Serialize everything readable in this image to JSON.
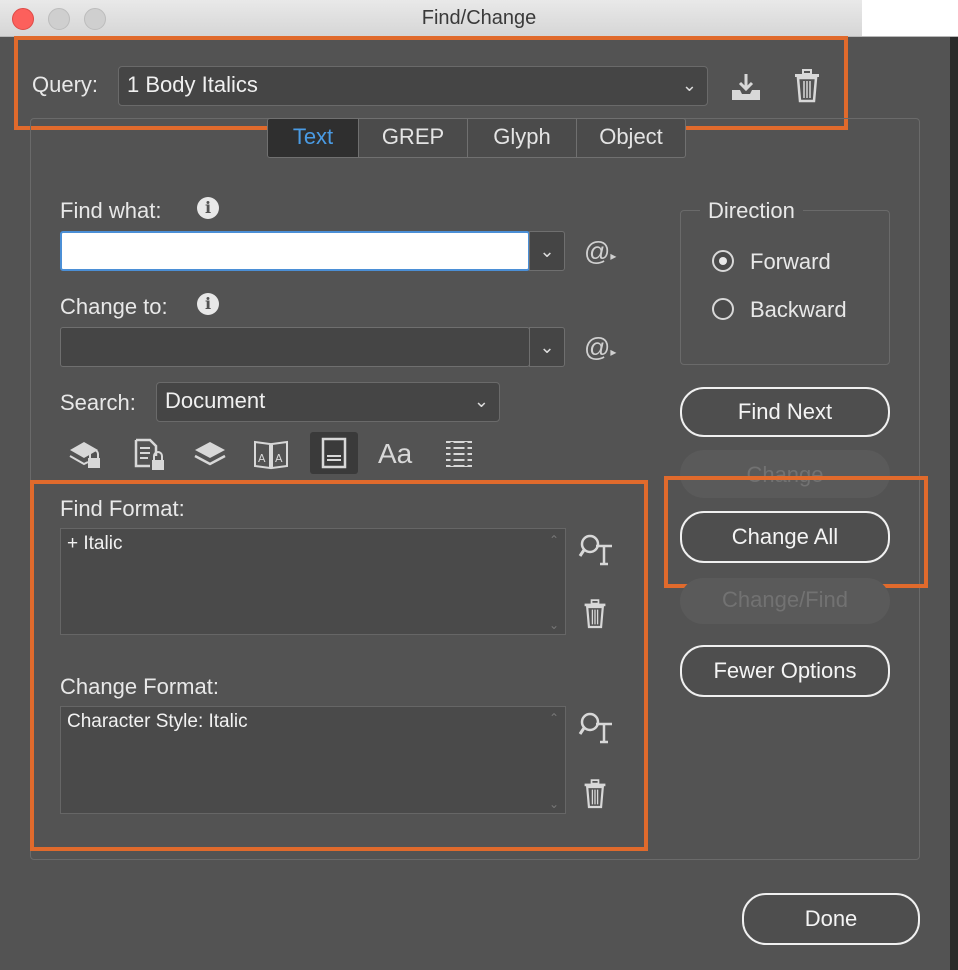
{
  "window": {
    "title": "Find/Change"
  },
  "query": {
    "label": "Query:",
    "value": "1 Body Italics"
  },
  "tabs": [
    {
      "label": "Text",
      "active": true
    },
    {
      "label": "GREP",
      "active": false
    },
    {
      "label": "Glyph",
      "active": false
    },
    {
      "label": "Object",
      "active": false
    }
  ],
  "find_what": {
    "label": "Find what:",
    "value": ""
  },
  "change_to": {
    "label": "Change to:",
    "value": ""
  },
  "search": {
    "label": "Search:",
    "value": "Document"
  },
  "direction": {
    "label": "Direction",
    "forward": "Forward",
    "backward": "Backward",
    "selected": "Forward"
  },
  "find_format": {
    "label": "Find Format:",
    "value": "+ Italic"
  },
  "change_format": {
    "label": "Change Format:",
    "value": "Character Style: Italic"
  },
  "buttons": {
    "find_next": "Find Next",
    "change": "Change",
    "change_all": "Change All",
    "change_find": "Change/Find",
    "fewer_options": "Fewer Options",
    "done": "Done"
  },
  "option_icons": [
    "locked-layers-icon",
    "locked-stories-icon",
    "hidden-layers-icon",
    "master-pages-icon",
    "footnotes-icon",
    "case-sensitive-icon",
    "whole-word-icon"
  ],
  "colors": {
    "highlight": "#e06a2c",
    "active_tab": "#4a9be4",
    "background": "#535353"
  }
}
